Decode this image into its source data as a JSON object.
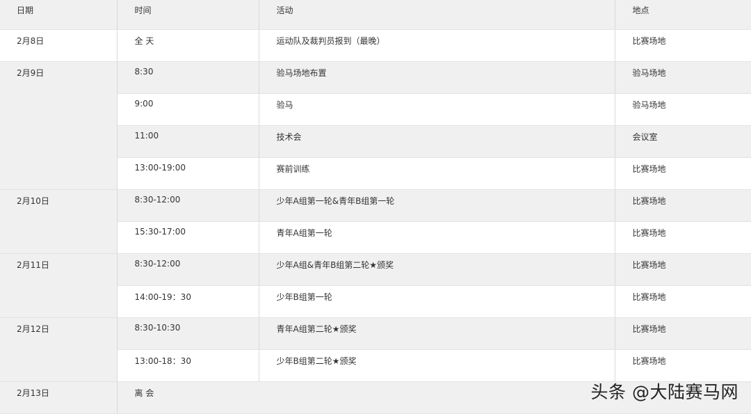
{
  "table": {
    "headers": {
      "date": "日期",
      "time": "时间",
      "activity": "活动",
      "place": "地点"
    },
    "rows": [
      {
        "date": "2月8日",
        "time": "全 天",
        "activity": "运动队及裁判员报到（最晚）",
        "place": "比赛场地"
      },
      {
        "date": "2月9日",
        "time": "8:30",
        "activity": "验马场地布置",
        "place": "验马场地"
      },
      {
        "time": "9:00",
        "activity": "验马",
        "place": "验马场地"
      },
      {
        "time": "11:00",
        "activity": "技术会",
        "place": "会议室"
      },
      {
        "time": "13:00-19:00",
        "activity": "赛前训练",
        "place": "比赛场地"
      },
      {
        "date": "2月10日",
        "time": "8:30-12:00",
        "activity": "少年A组第一轮&青年B组第一轮",
        "place": "比赛场地"
      },
      {
        "time": "15:30-17:00",
        "activity": "青年A组第一轮",
        "place": "比赛场地"
      },
      {
        "date": "2月11日",
        "time": "8:30-12:00",
        "activity": "少年A组&青年B组第二轮★颁奖",
        "place": "比赛场地"
      },
      {
        "time": "14:00-19：30",
        "activity": "少年B组第一轮",
        "place": "比赛场地"
      },
      {
        "date": "2月12日",
        "time": "8:30-10:30",
        "activity": "青年A组第二轮★颁奖",
        "place": "比赛场地"
      },
      {
        "time": "13:00-18：30",
        "activity": "少年B组第二轮★颁奖",
        "place": "比赛场地"
      },
      {
        "date": "2月13日",
        "time": "离 会"
      }
    ]
  },
  "watermark": "头条 @大陆赛马网"
}
